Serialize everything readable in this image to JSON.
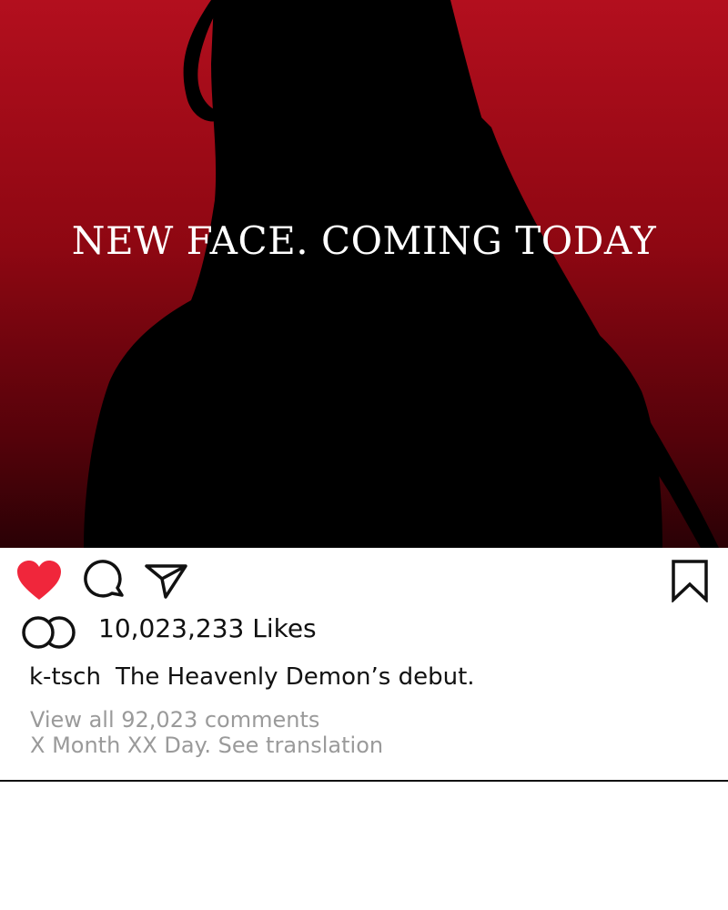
{
  "post": {
    "headline": "NEW FACE. COMING TODAY",
    "liked": true,
    "likes_text": "10,023,233 Likes",
    "caption_user": "k-tsch",
    "caption_text": "The Heavenly Demon’s debut.",
    "view_comments": "View all 92,023 comments",
    "date_line": "X Month XX Day. See translation"
  },
  "icons": {
    "like": "heart-icon",
    "comment": "comment-bubble-icon",
    "share": "paper-plane-icon",
    "save": "bookmark-icon",
    "liked_by": "overlapping-circles-icon"
  },
  "colors": {
    "heart": "#f0263b",
    "image_red": "#b30f1e",
    "meta_gray": "#9a9a9a"
  }
}
